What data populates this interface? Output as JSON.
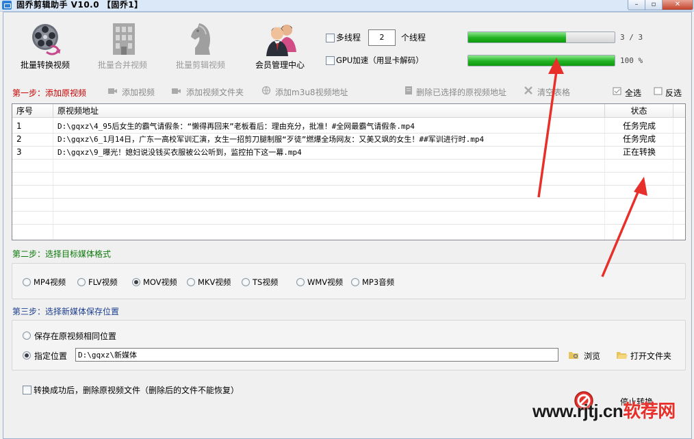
{
  "window": {
    "title": "固乔剪辑助手 V10.0 【固乔1】",
    "controls": {
      "minimize": "–",
      "maximize": "▫",
      "close": "✕"
    }
  },
  "toolbar": {
    "items": [
      {
        "label": "批量转换视频",
        "icon": "film-reel-icon",
        "enabled": true
      },
      {
        "label": "批量合并视频",
        "icon": "building-icon",
        "enabled": false
      },
      {
        "label": "批量剪辑视频",
        "icon": "chess-knight-icon",
        "enabled": false
      },
      {
        "label": "会员管理中心",
        "icon": "users-icon",
        "enabled": true
      }
    ]
  },
  "threading": {
    "multithread_label": "多线程",
    "multithread_checked": false,
    "thread_count": "2",
    "thread_unit": "个线程",
    "gpu_label": "GPU加速（用显卡解码）",
    "gpu_checked": false
  },
  "progress": {
    "file_progress_fraction": 0.67,
    "file_progress_text": "3 / 3",
    "overall_progress_fraction": 1.0,
    "overall_progress_text": "100 %",
    "fill_color": "#21b321"
  },
  "step1": {
    "label": "第一步：添加原视频",
    "label_color": "#c80000",
    "actions": {
      "add_video": "添加视频",
      "add_folder": "添加视频文件夹",
      "add_m3u8": "添加m3u8视频地址",
      "delete_selected": "删除已选择的原视频地址",
      "clear_table": "清空表格",
      "select_all": "全选",
      "invert_select": "反选"
    }
  },
  "table": {
    "headers": {
      "index": "序号",
      "path": "原视频地址",
      "status": "状态"
    },
    "rows": [
      {
        "index": "1",
        "path": "D:\\gqxz\\4_95后女生的霸气请假条：“懒得再回来”老板看后：理由充分，批准！#全网最霸气请假条.mp4",
        "status": "任务完成"
      },
      {
        "index": "2",
        "path": "D:\\gqxz\\6_1月14日，广东一高校军训汇演，女生一招剪刀腿制服“歹徒”燃爆全场网友：又美又飒的女生！##军训进行时.mp4",
        "status": "任务完成"
      },
      {
        "index": "3",
        "path": "D:\\gqxz\\9_曝光！媳妇说没钱买衣服被公公听到，监控拍下这一幕.mp4",
        "status": "正在转换"
      }
    ]
  },
  "step2": {
    "label": "第二步：选择目标媒体格式",
    "label_color": "#0a7a0a",
    "formats": [
      {
        "label": "MP4视频",
        "selected": false
      },
      {
        "label": "FLV视频",
        "selected": false
      },
      {
        "label": "MOV视频",
        "selected": true
      },
      {
        "label": "MKV视频",
        "selected": false
      },
      {
        "label": "TS视频",
        "selected": false
      },
      {
        "label": "WMV视频",
        "selected": false
      },
      {
        "label": "MP3音频",
        "selected": false
      }
    ]
  },
  "step3": {
    "label": "第三步：选择新媒体保存位置",
    "label_color": "#1b3f8f",
    "same_location_label": "保存在原视频相同位置",
    "custom_location_label": "指定位置",
    "custom_selected": true,
    "path_value": "D:\\gqxz\\新媒体",
    "browse_label": "浏览",
    "open_folder_label": "打开文件夹"
  },
  "footer": {
    "delete_source_label": "转换成功后，删除原视频文件（删除后的文件不能恢复）",
    "delete_source_checked": false,
    "stop_label": "停止转换"
  },
  "watermark": {
    "text_latin": "www.rjtj.cn",
    "text_cjk": "软荐网",
    "accent": "#e8302a"
  }
}
